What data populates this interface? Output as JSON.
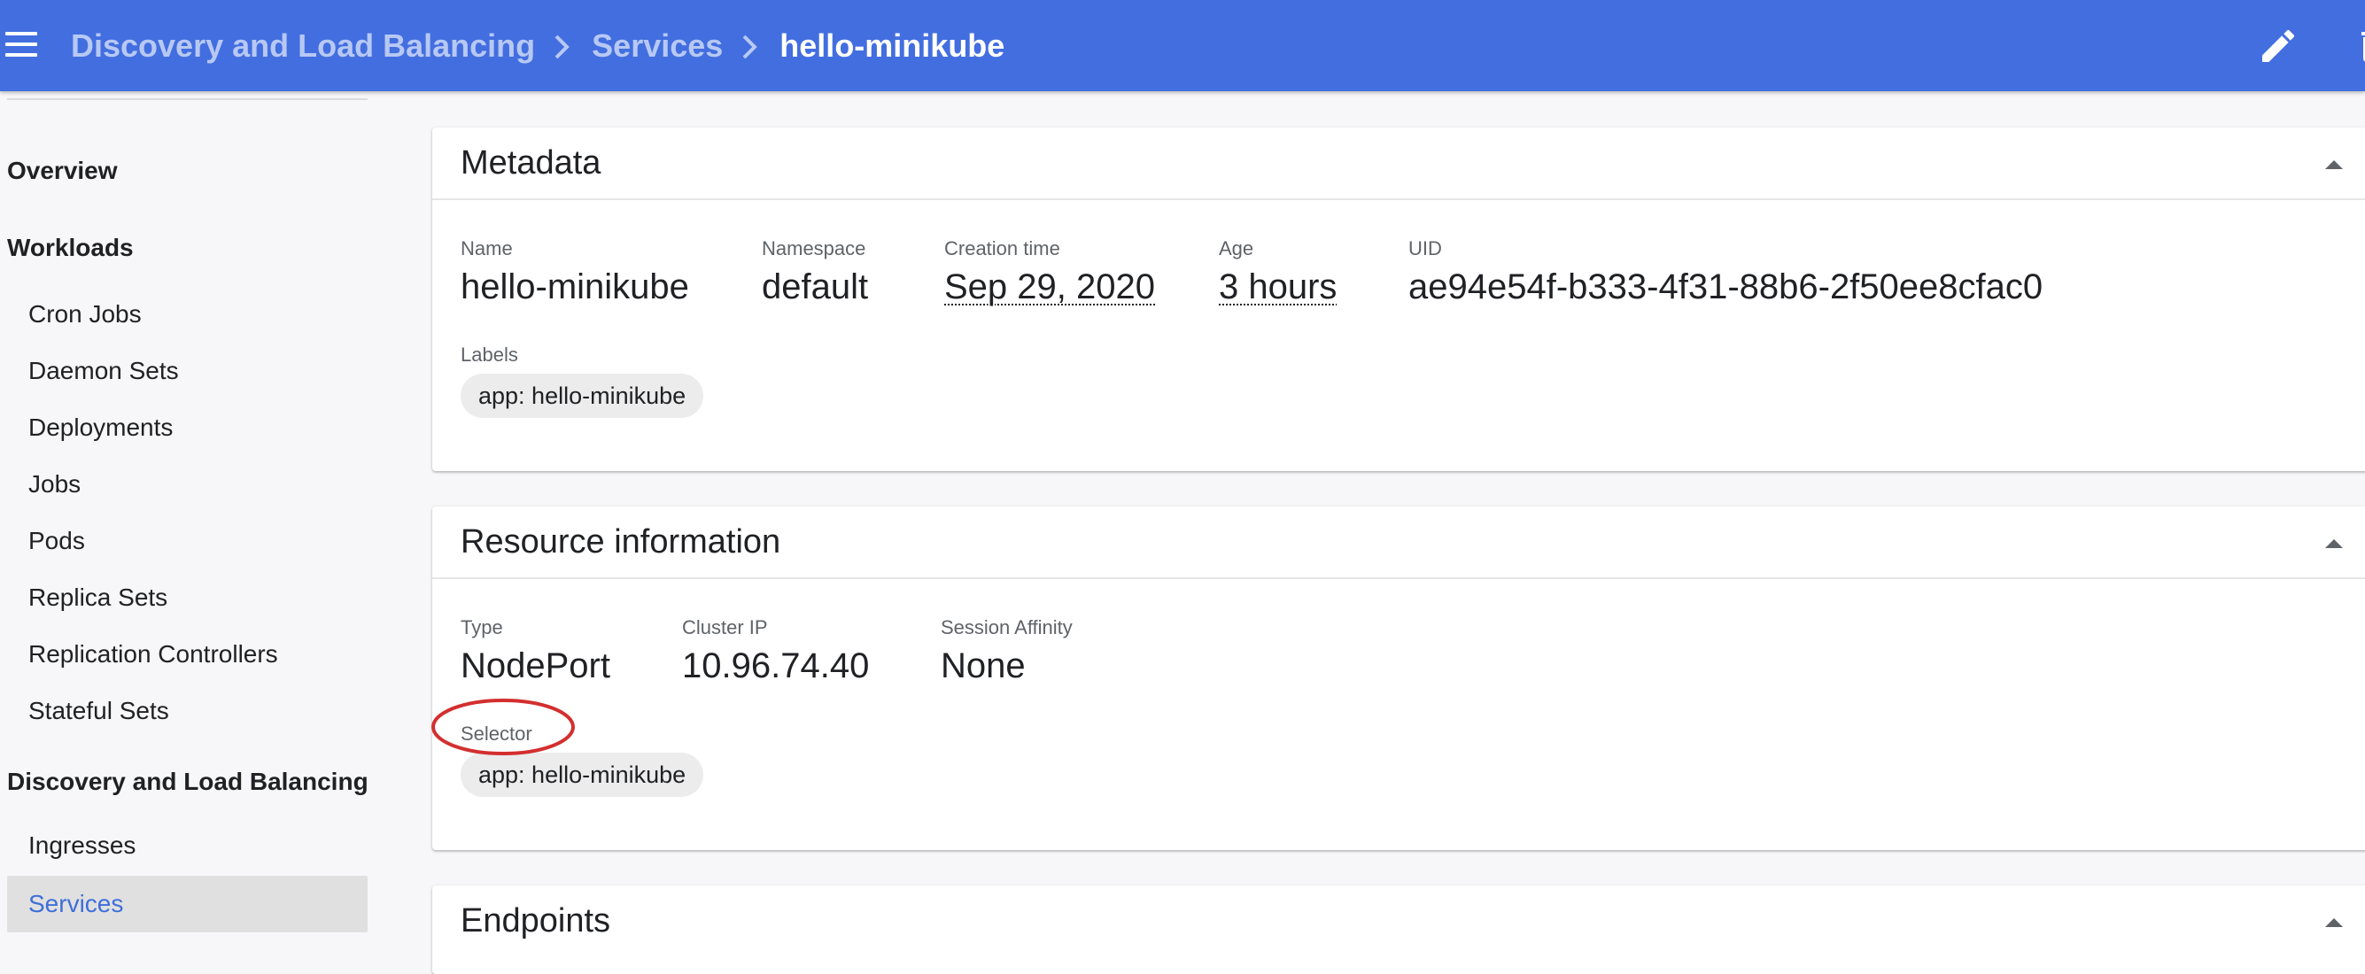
{
  "header": {
    "breadcrumbs": [
      {
        "label": "Discovery and Load Balancing"
      },
      {
        "label": "Services"
      }
    ],
    "current": "hello-minikube",
    "icons": {
      "menu": "menu-icon",
      "edit": "edit-icon",
      "delete": "trash-icon",
      "separator": "chevron-right-icon"
    },
    "bar_color": "#426ee0"
  },
  "sidebar": {
    "overview": "Overview",
    "workloads": {
      "label": "Workloads",
      "items": [
        "Cron Jobs",
        "Daemon Sets",
        "Deployments",
        "Jobs",
        "Pods",
        "Replica Sets",
        "Replication Controllers",
        "Stateful Sets"
      ]
    },
    "discovery": {
      "label": "Discovery and Load Balancing",
      "items": [
        "Ingresses",
        "Services"
      ],
      "active": "Services"
    },
    "active_color": "#3f6fd9"
  },
  "metadata": {
    "title": "Metadata",
    "name": {
      "label": "Name",
      "value": "hello-minikube"
    },
    "namespace": {
      "label": "Namespace",
      "value": "default"
    },
    "creation_time": {
      "label": "Creation time",
      "value": "Sep 29, 2020"
    },
    "age": {
      "label": "Age",
      "value": "3 hours"
    },
    "uid": {
      "label": "UID",
      "value": "ae94e54f-b333-4f31-88b6-2f50ee8cfac0"
    },
    "labels": {
      "label": "Labels",
      "chips": [
        "app: hello-minikube"
      ]
    }
  },
  "resource": {
    "title": "Resource information",
    "type": {
      "label": "Type",
      "value": "NodePort"
    },
    "cluster_ip": {
      "label": "Cluster IP",
      "value": "10.96.74.40"
    },
    "session_affinity": {
      "label": "Session Affinity",
      "value": "None"
    },
    "selector": {
      "label": "Selector",
      "chips": [
        "app: hello-minikube"
      ]
    }
  },
  "endpoints": {
    "title": "Endpoints"
  },
  "annotation": {
    "color": "#d32f2f",
    "target": "selector-label"
  }
}
